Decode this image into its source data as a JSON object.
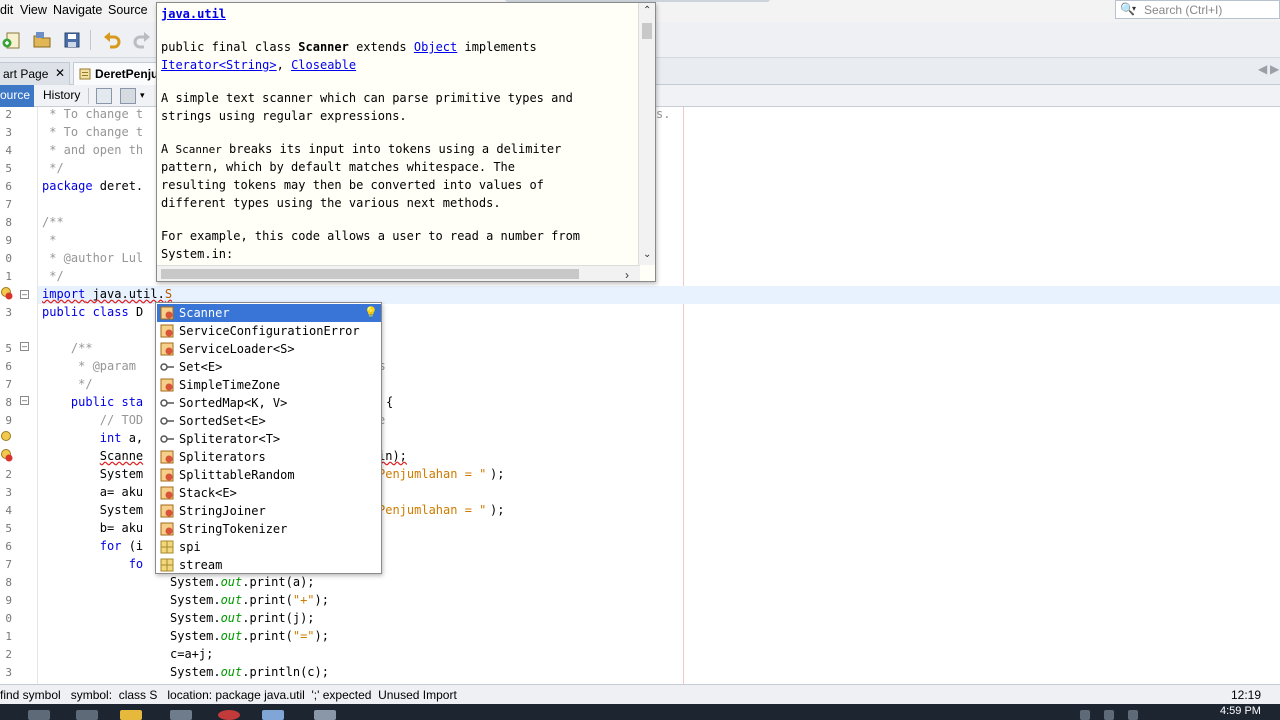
{
  "menu": {
    "items": [
      "dit",
      "View",
      "Navigate",
      "Source"
    ]
  },
  "search": {
    "placeholder": "Search (Ctrl+I)"
  },
  "tabs": {
    "start_page": "art Page",
    "file": "DeretPenju"
  },
  "editor_tabs": {
    "source": "ource",
    "history": "History"
  },
  "gutter": {
    "line_numbers": [
      "2",
      "3",
      "4",
      "5",
      "6",
      "7",
      "8",
      "9",
      "0",
      "1",
      "2",
      "3",
      "4",
      "5",
      "6",
      "7",
      "8",
      "9",
      "0",
      "1",
      "2",
      "3",
      "4",
      "5",
      "6",
      "7",
      "8",
      "9",
      "0",
      "1",
      "2",
      "3",
      "3"
    ]
  },
  "code": {
    "l2": " * To change t",
    "l2_tail": "s.",
    "l3": " * To change t",
    "l4": " * and open th",
    "l5": " */",
    "l6_kw": "package",
    "l6_rest": " deret.",
    "l8": "/**",
    "l9": " *",
    "l10": " * @author Lul",
    "l11": " */",
    "l12_kw": "import",
    "l12_rest": " java.util.",
    "l12_err": "S",
    "l13_kw1": "public",
    "l13_kw2": " class",
    "l13_rest": " D",
    "l15": "    /**",
    "l16": "     * @param",
    "l16_tail": "nts",
    "l17": "     */",
    "l18_kw1": "    public",
    "l18_kw2": " sta",
    "l18_tail": "{",
    "l19": "        // TOD",
    "l19_tail": "e",
    "l20_kw": "        int",
    "l20_rest": " a,",
    "l21_err": "Scanne",
    "l21_tail": "in);",
    "l22": "        System",
    "l22_str": "Penjumlahan = \"",
    "l22_end": ");",
    "l23": "        a= aku",
    "l24": "        System",
    "l24_str": "Penjumlahan = \"",
    "l24_end": ");",
    "l25": "        b= aku",
    "l26_kw": "        for",
    "l26_rest": " (i",
    "l27_kw": "            fo",
    "l28": "System.",
    "l28_it": "out",
    "l28_rest": ".print(a);",
    "l29": "System.",
    "l29_it": "out",
    "l29_rest": ".print(",
    "l29_str": "\"+\"",
    "l29_end": ");",
    "l30": "System.",
    "l30_it": "out",
    "l30_rest": ".print(j);",
    "l31": "System.",
    "l31_it": "out",
    "l31_rest": ".print(",
    "l31_str": "\"=\"",
    "l31_end": ");",
    "l32": "c=a+j;",
    "l33": "System.",
    "l33_it": "out",
    "l33_rest": ".println(c);"
  },
  "javadoc": {
    "package": "java.util",
    "sig_1": "public final class ",
    "sig_class": "Scanner",
    "sig_2": " extends ",
    "sig_object": "Object",
    "sig_3": " implements",
    "sig_iter": "Iterator<",
    "sig_string": "String",
    "sig_iter_end": ">",
    "sig_comma": ", ",
    "sig_closeable": "Closeable",
    "p1_a": "A simple text scanner which can parse primitive types and",
    "p1_b": "strings using regular expressions.",
    "p2_a1": "A ",
    "p2_a_code": "Scanner",
    "p2_a2": " breaks its input into tokens using a delimiter",
    "p2_b": "pattern, which by default matches whitespace. The",
    "p2_c": "resulting tokens may then be converted into values of",
    "p2_d": "different types using the various next methods.",
    "p3_a": "For example, this code allows a user to read a number from",
    "p3_b": "System.in:"
  },
  "completion": {
    "items": [
      {
        "label": "Scanner",
        "kind": "class"
      },
      {
        "label": "ServiceConfigurationError",
        "kind": "class"
      },
      {
        "label": "ServiceLoader<S>",
        "kind": "class"
      },
      {
        "label": "Set<E>",
        "kind": "interface"
      },
      {
        "label": "SimpleTimeZone",
        "kind": "class"
      },
      {
        "label": "SortedMap<K, V>",
        "kind": "interface"
      },
      {
        "label": "SortedSet<E>",
        "kind": "interface"
      },
      {
        "label": "Spliterator<T>",
        "kind": "interface"
      },
      {
        "label": "Spliterators",
        "kind": "class"
      },
      {
        "label": "SplittableRandom",
        "kind": "class"
      },
      {
        "label": "Stack<E>",
        "kind": "class"
      },
      {
        "label": "StringJoiner",
        "kind": "class"
      },
      {
        "label": "StringTokenizer",
        "kind": "class"
      },
      {
        "label": "spi",
        "kind": "package"
      },
      {
        "label": "stream",
        "kind": "package"
      }
    ]
  },
  "status": {
    "message": "find symbol   symbol:  class S   location: package java.util  ';' expected  Unused Import",
    "position": "12:19"
  },
  "taskbar": {
    "clock": "4:59 PM"
  },
  "colors": {
    "selection": "#3875d7",
    "keyword": "#0000e6",
    "string": "#ce7b00",
    "field": "#009900"
  }
}
